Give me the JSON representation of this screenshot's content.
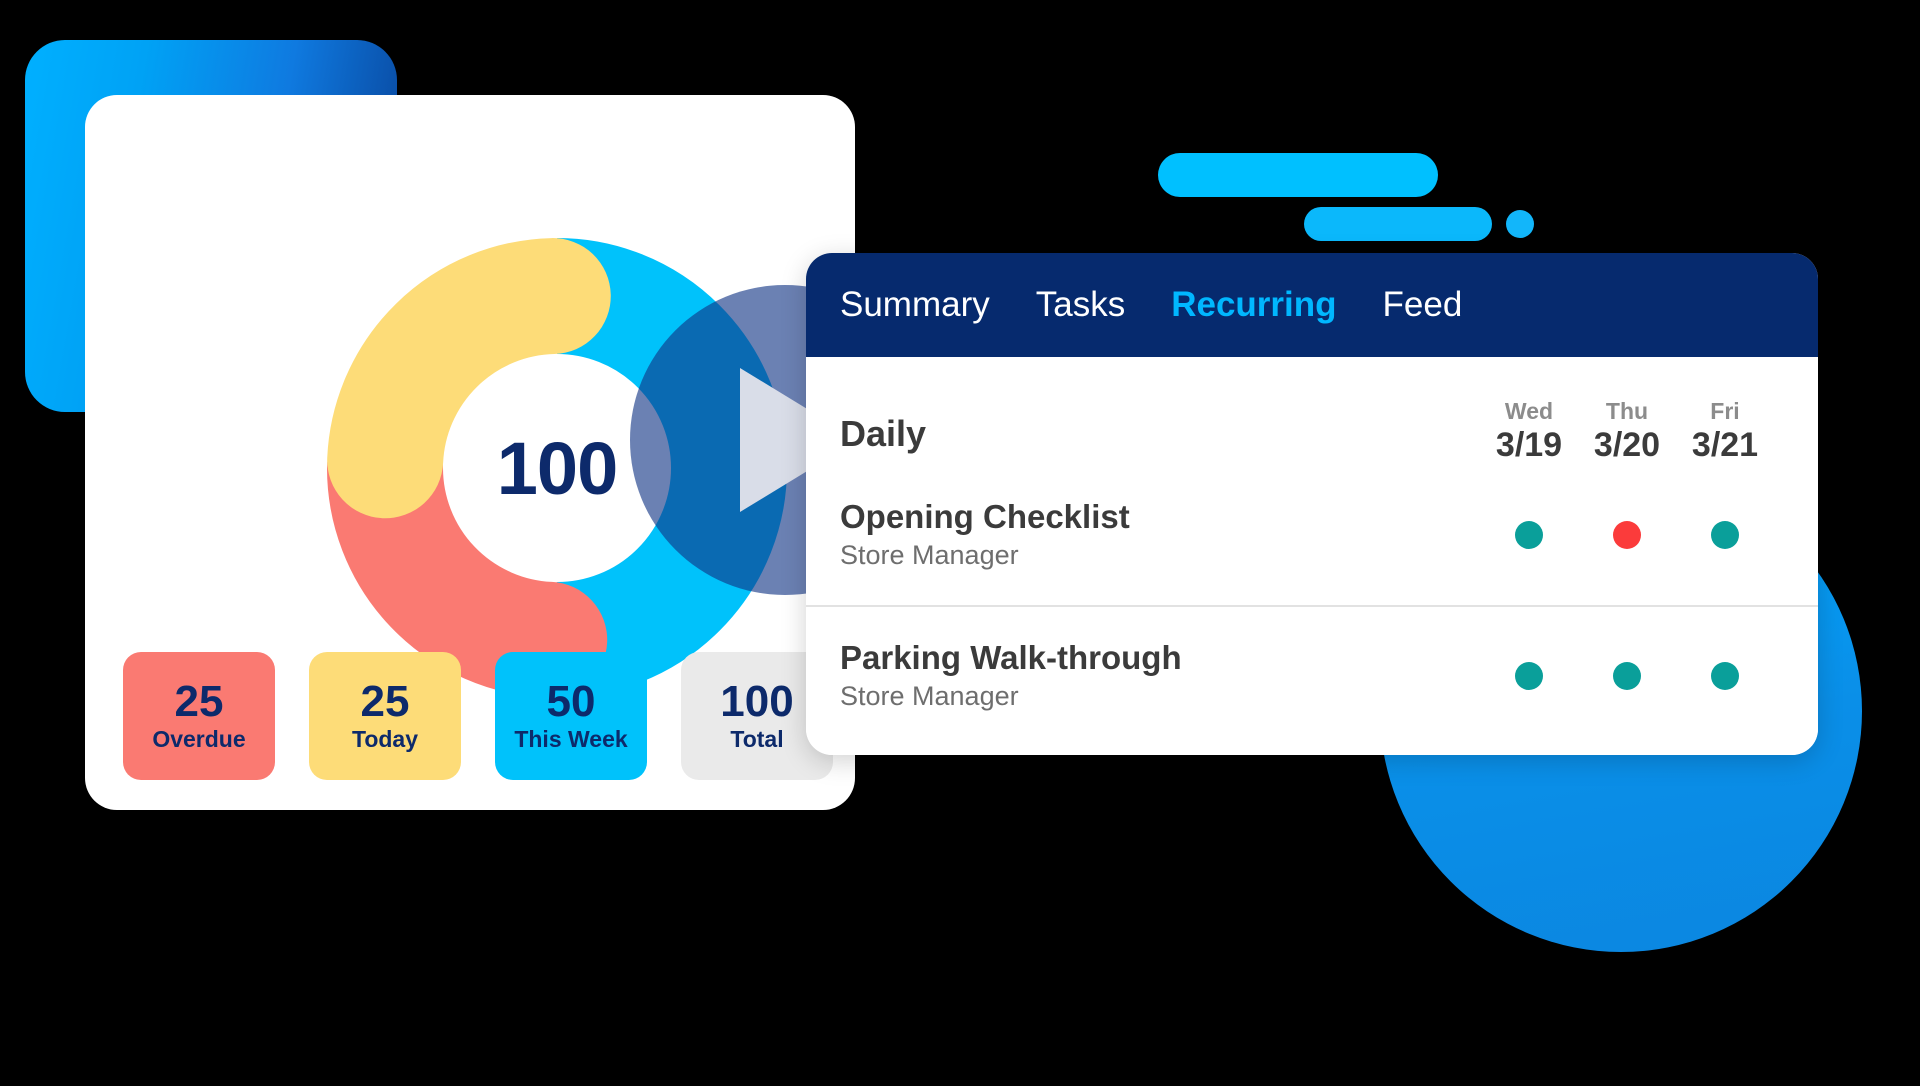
{
  "background": {
    "square_gradient_from": "#00b0ff",
    "square_gradient_to": "#0a3f8f",
    "circle_color": "#00a8ff",
    "bar_color": "#00c0ff",
    "canvas_color": "#000000"
  },
  "dashboard_card": {
    "donut_center_value": "100",
    "stats": [
      {
        "value": "25",
        "label": "Overdue",
        "bg": "#fa7a72",
        "text": "#0d2a6b"
      },
      {
        "value": "25",
        "label": "Today",
        "bg": "#fddc78",
        "text": "#0d2a6b"
      },
      {
        "value": "50",
        "label": "This Week",
        "bg": "#00c2fb",
        "text": "#0d2a6b"
      },
      {
        "value": "100",
        "label": "Total",
        "bg": "#eaeaea",
        "text": "#0d2a6b"
      }
    ]
  },
  "chart_data": {
    "type": "pie",
    "title": "",
    "center_label": "100",
    "categories": [
      "This Week",
      "Overdue",
      "Today"
    ],
    "values": [
      50,
      25,
      25
    ],
    "colors": [
      "#00c2fb",
      "#fa7a72",
      "#fddc78"
    ],
    "total": 100,
    "units": "tasks",
    "donut": true,
    "inner_radius_ratio": 0.5,
    "legend": "bottom-cards",
    "annotations": [
      "Overdue 25",
      "Today 25",
      "This Week 50",
      "Total 100"
    ]
  },
  "media": {
    "play_button_label": "play-video",
    "play_triangle_color": "#d9dde8",
    "overlay_color": "rgba(16,52,133,0.62)"
  },
  "panel": {
    "tabs": [
      {
        "label": "Summary",
        "active": false
      },
      {
        "label": "Tasks",
        "active": false
      },
      {
        "label": "Recurring",
        "active": true
      },
      {
        "label": "Feed",
        "active": false
      }
    ],
    "active_tab_color": "#00b7ff",
    "nav_bg": "#062a6e",
    "schedule": {
      "title": "Daily",
      "days": [
        {
          "name": "Wed",
          "date": "3/19"
        },
        {
          "name": "Thu",
          "date": "3/20"
        },
        {
          "name": "Fri",
          "date": "3/21"
        }
      ],
      "rows": [
        {
          "name": "Opening Checklist",
          "role": "Store Manager",
          "statuses": [
            "complete",
            "missed",
            "complete"
          ],
          "status_colors": [
            "#0a9f9a",
            "#fb3b3b",
            "#0a9f9a"
          ]
        },
        {
          "name": "Parking Walk-through",
          "role": "Store Manager",
          "statuses": [
            "complete",
            "complete",
            "complete"
          ],
          "status_colors": [
            "#0a9f9a",
            "#0a9f9a",
            "#0a9f9a"
          ]
        }
      ]
    }
  }
}
